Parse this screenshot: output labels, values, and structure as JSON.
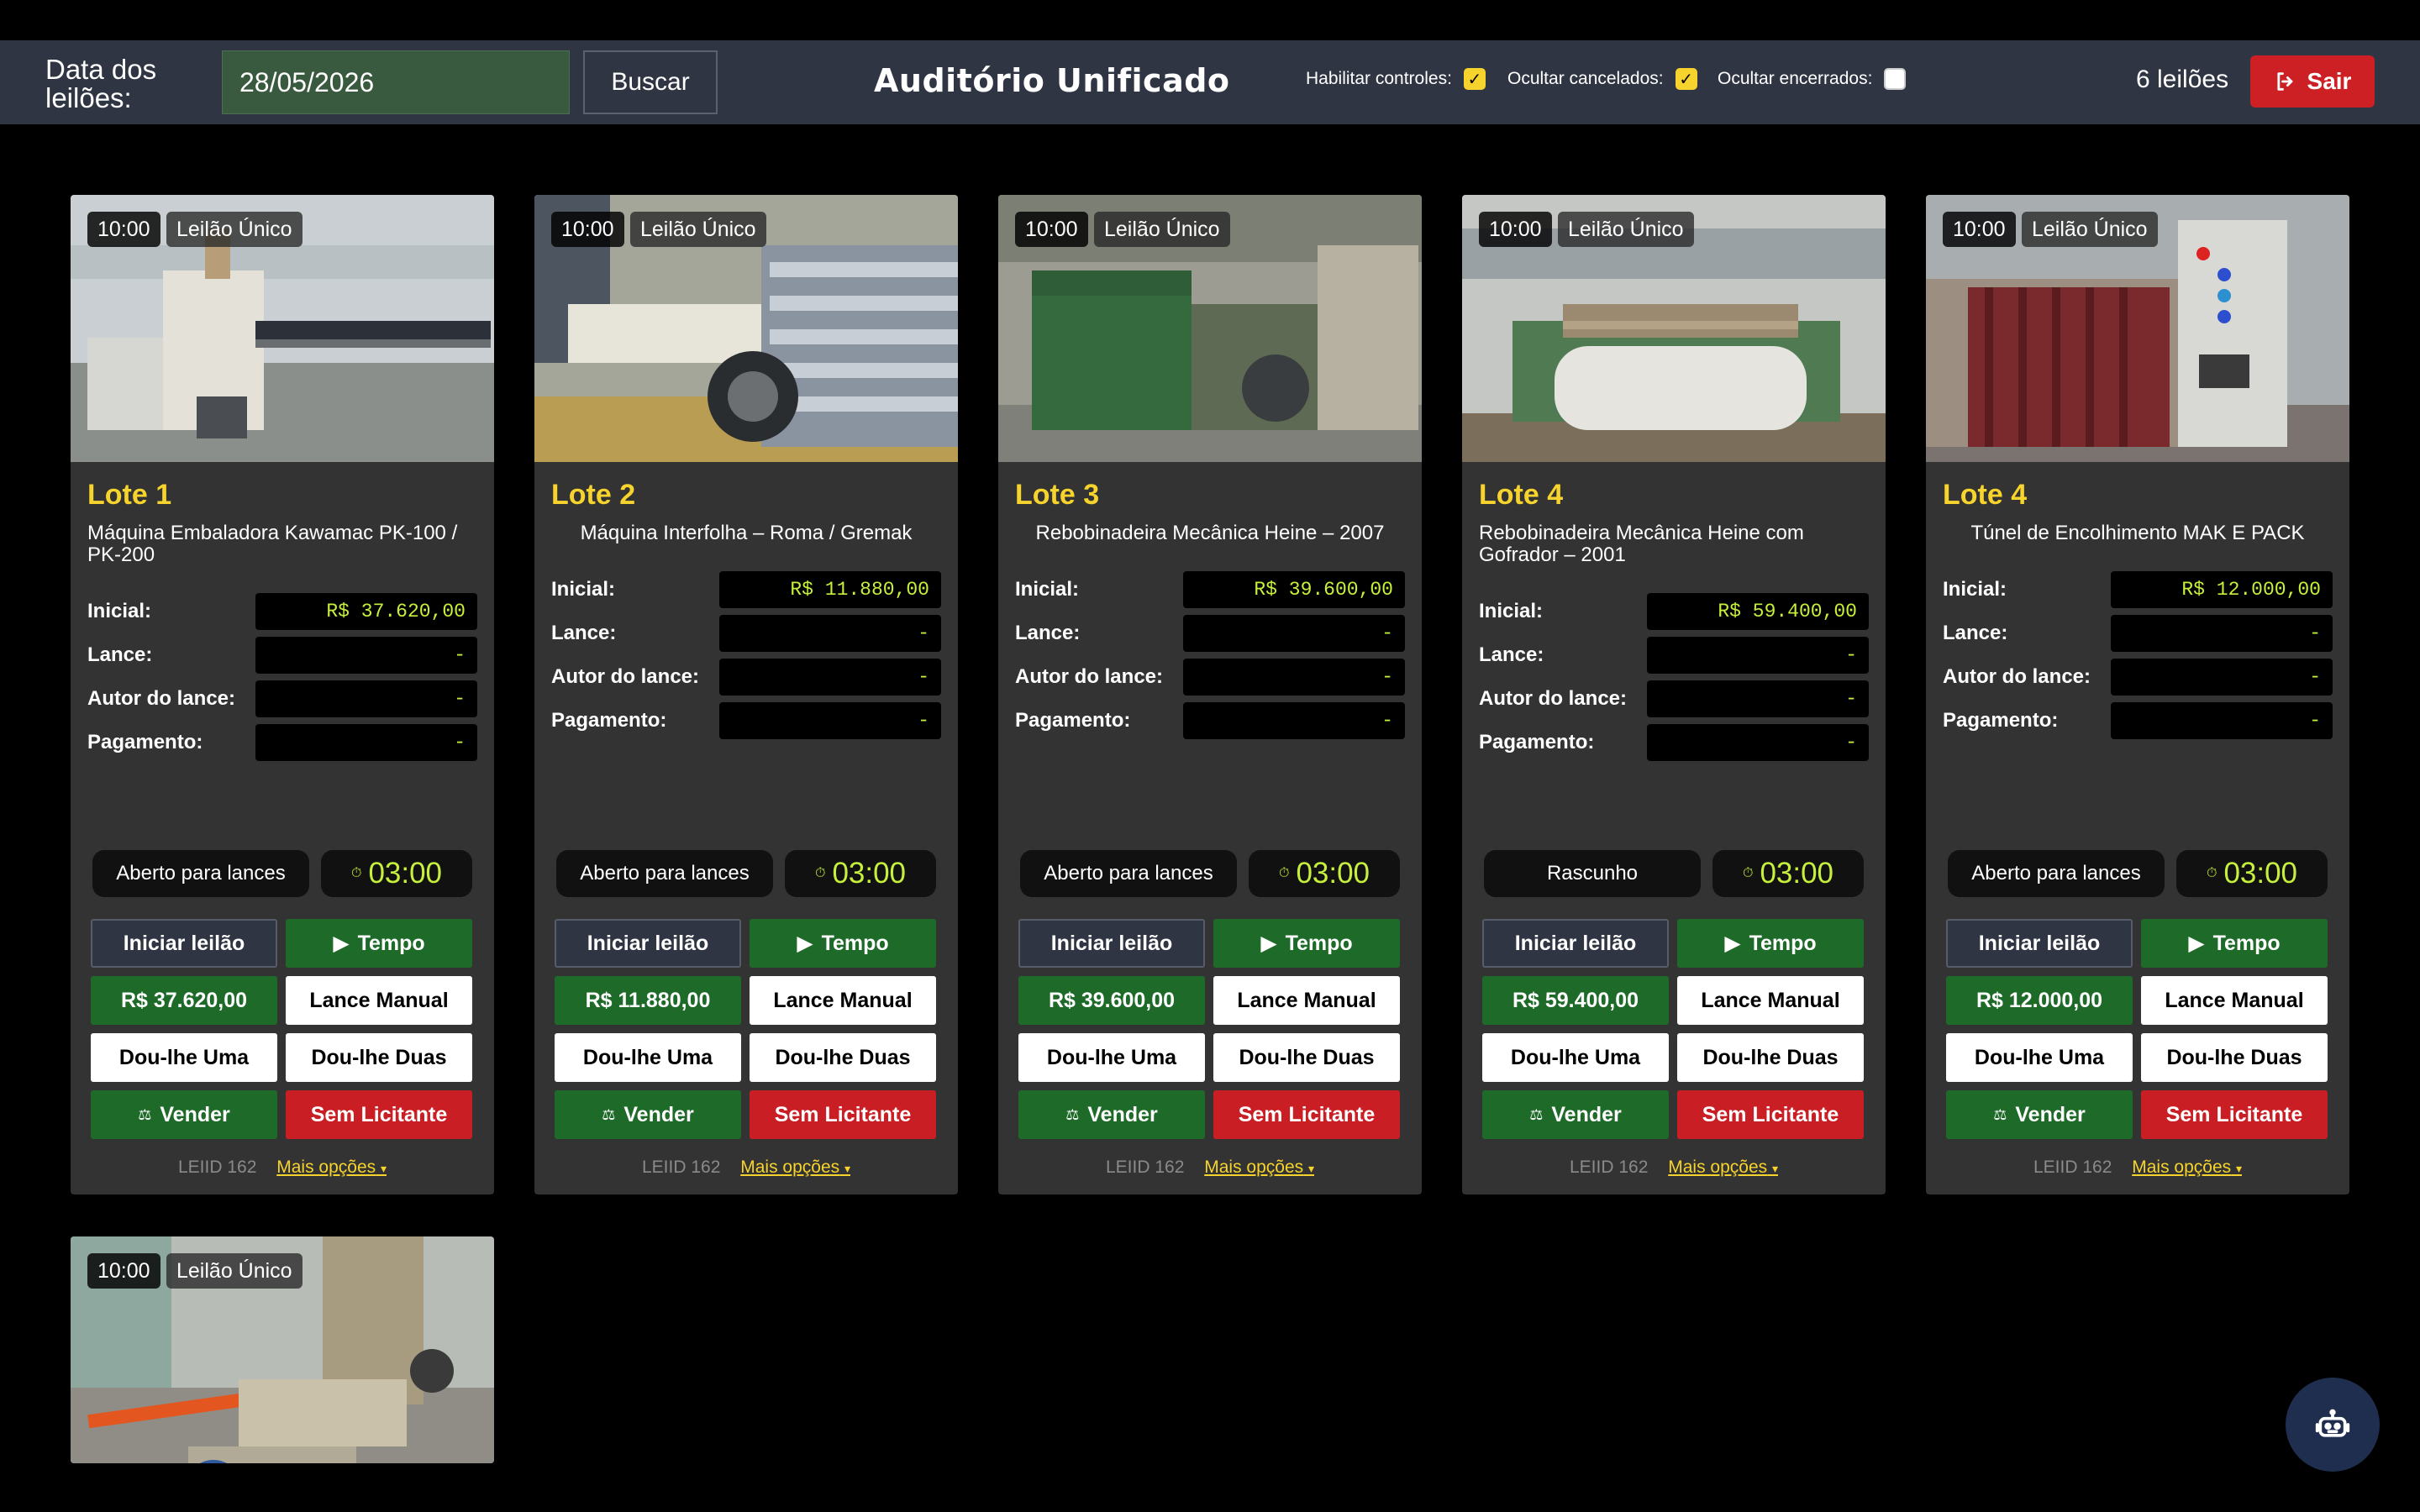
{
  "header": {
    "date_label": "Data dos leilões:",
    "date_value": "28/05/2026",
    "search_label": "Buscar",
    "title": "Auditório Unificado",
    "options": [
      {
        "label": "Habilitar controles:",
        "checked": true
      },
      {
        "label": "Ocultar cancelados:",
        "checked": true
      },
      {
        "label": "Ocultar encerrados:",
        "checked": false
      }
    ],
    "count": "6 leilões",
    "exit_label": "Sair"
  },
  "labels": {
    "inicial": "Inicial:",
    "lance": "Lance:",
    "autor": "Autor do lance:",
    "pagamento": "Pagamento:",
    "iniciar": "Iniciar leilão",
    "tempo": "Tempo",
    "lance_manual": "Lance Manual",
    "dou_uma": "Dou-lhe Uma",
    "dou_duas": "Dou-lhe Duas",
    "vender": "Vender",
    "sem_licitante": "Sem Licitante",
    "mais_opcoes": "Mais opções"
  },
  "cards": [
    {
      "time": "10:00",
      "kind": "Leilão Único",
      "lot": "Lote 1",
      "desc": "Máquina Embaladora Kawamac PK-100 / PK-200",
      "inicial": "R$ 37.620,00",
      "lance": "-",
      "autor": "-",
      "pagamento": "-",
      "status": "Aberto para lances",
      "timer": "03:00",
      "price_btn": "R$ 37.620,00",
      "leiid": "LEIID 162"
    },
    {
      "time": "10:00",
      "kind": "Leilão Único",
      "lot": "Lote 2",
      "desc": "Máquina Interfolha – Roma / Gremak",
      "inicial": "R$ 11.880,00",
      "lance": "-",
      "autor": "-",
      "pagamento": "-",
      "status": "Aberto para lances",
      "timer": "03:00",
      "price_btn": "R$ 11.880,00",
      "leiid": "LEIID 162"
    },
    {
      "time": "10:00",
      "kind": "Leilão Único",
      "lot": "Lote 3",
      "desc": "Rebobinadeira Mecânica Heine – 2007",
      "inicial": "R$ 39.600,00",
      "lance": "-",
      "autor": "-",
      "pagamento": "-",
      "status": "Aberto para lances",
      "timer": "03:00",
      "price_btn": "R$ 39.600,00",
      "leiid": "LEIID 162"
    },
    {
      "time": "10:00",
      "kind": "Leilão Único",
      "lot": "Lote 4",
      "desc": "Rebobinadeira Mecânica Heine com Gofrador – 2001",
      "inicial": "R$ 59.400,00",
      "lance": "-",
      "autor": "-",
      "pagamento": "-",
      "status": "Rascunho",
      "timer": "03:00",
      "price_btn": "R$ 59.400,00",
      "leiid": "LEIID 162"
    },
    {
      "time": "10:00",
      "kind": "Leilão Único",
      "lot": "Lote 4",
      "desc": "Túnel de Encolhimento MAK E PACK",
      "inicial": "R$ 12.000,00",
      "lance": "-",
      "autor": "-",
      "pagamento": "-",
      "status": "Aberto para lances",
      "timer": "03:00",
      "price_btn": "R$ 12.000,00",
      "leiid": "LEIID 162"
    },
    {
      "time": "10:00",
      "kind": "Leilão Único"
    }
  ],
  "colors": {
    "accent": "#f6d32d",
    "green": "#1e6b29",
    "red": "#c81e24",
    "value": "#c6f03c"
  },
  "icons": [
    "exit-icon",
    "timer-icon",
    "play-icon",
    "scale-icon",
    "caret-down-icon",
    "robot-icon"
  ]
}
